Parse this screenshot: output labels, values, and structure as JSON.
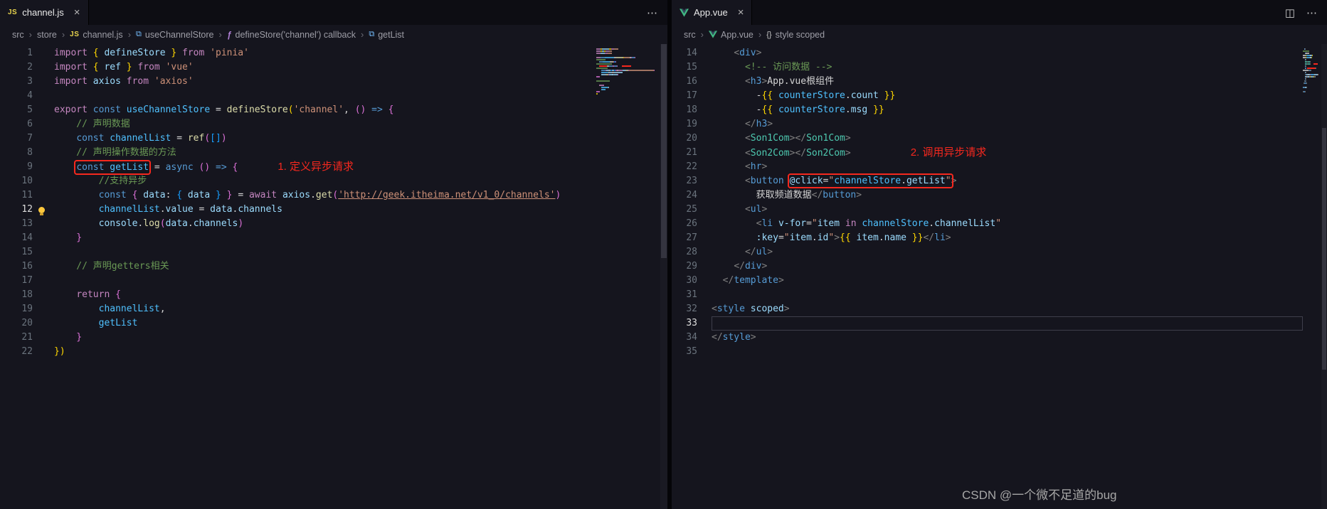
{
  "theme": {
    "editor_bg": "#15151e",
    "tabbar_bg": "#0d0d13",
    "annotation_red": "#f5281e"
  },
  "syntax": {
    "p": "#d4d4d4",
    "kw": "#c586c0",
    "st": "#569cd6",
    "v": "#9cdcfe",
    "cv": "#4fc1ff",
    "f": "#dcdcaa",
    "s": "#ce9178",
    "su": "#ce9178",
    "c": "#6a9955",
    "tp": "#808080",
    "ct": "#4ec9b0",
    "b1": "#ffd700",
    "b2": "#da70d6",
    "b3": "#179fff"
  },
  "left_pane": {
    "tab": {
      "badge": "JS",
      "label": "channel.js",
      "close": "×"
    },
    "actions": [
      {
        "name": "more-actions",
        "glyph": "⋯"
      }
    ],
    "breadcrumbs": [
      {
        "label": "src"
      },
      {
        "label": "store"
      },
      {
        "label": "channel.js",
        "icon": "js"
      },
      {
        "label": "useChannelStore",
        "icon": "sym"
      },
      {
        "label": "defineStore('channel') callback",
        "icon": "fn"
      },
      {
        "label": "getList",
        "icon": "sym"
      }
    ],
    "code": {
      "lines": [
        {
          "n": 1,
          "seg": [
            [
              "kw",
              "import "
            ],
            [
              "b1",
              "{ "
            ],
            [
              "v",
              "defineStore"
            ],
            [
              "b1",
              " } "
            ],
            [
              "kw",
              "from "
            ],
            [
              "s",
              "'pinia'"
            ]
          ]
        },
        {
          "n": 2,
          "seg": [
            [
              "kw",
              "import "
            ],
            [
              "b1",
              "{ "
            ],
            [
              "v",
              "ref"
            ],
            [
              "b1",
              " } "
            ],
            [
              "kw",
              "from "
            ],
            [
              "s",
              "'vue'"
            ]
          ]
        },
        {
          "n": 3,
          "seg": [
            [
              "kw",
              "import "
            ],
            [
              "v",
              "axios "
            ],
            [
              "kw",
              "from "
            ],
            [
              "s",
              "'axios'"
            ]
          ]
        },
        {
          "n": 4,
          "seg": []
        },
        {
          "n": 5,
          "seg": [
            [
              "kw",
              "export "
            ],
            [
              "st",
              "const "
            ],
            [
              "cv",
              "useChannelStore"
            ],
            [
              "p",
              " = "
            ],
            [
              "f",
              "defineStore"
            ],
            [
              "b1",
              "("
            ],
            [
              "s",
              "'channel'"
            ],
            [
              "p",
              ", "
            ],
            [
              "b2",
              "()"
            ],
            [
              "st",
              " => "
            ],
            [
              "b2",
              "{"
            ]
          ]
        },
        {
          "n": 6,
          "seg": [
            [
              "c",
              "    // 声明数据"
            ]
          ]
        },
        {
          "n": 7,
          "seg": [
            [
              "p",
              "    "
            ],
            [
              "st",
              "const "
            ],
            [
              "cv",
              "channelList"
            ],
            [
              "p",
              " = "
            ],
            [
              "f",
              "ref"
            ],
            [
              "b2",
              "("
            ],
            [
              "b3",
              "[]"
            ],
            [
              "b2",
              ")"
            ]
          ]
        },
        {
          "n": 8,
          "seg": [
            [
              "c",
              "    // 声明操作数据的方法"
            ]
          ]
        },
        {
          "n": 9,
          "seg": [
            [
              "p",
              "    "
            ],
            {
              "box": [
                [
                  "st",
                  "const "
                ],
                [
                  "cv",
                  "getList"
                ]
              ]
            },
            [
              "p",
              " = "
            ],
            [
              "st",
              "async "
            ],
            [
              "b2",
              "()"
            ],
            [
              "st",
              " => "
            ],
            [
              "b2",
              "{"
            ]
          ],
          "note": {
            "text": "1. 定义异步请求",
            "gap": 56
          }
        },
        {
          "n": 10,
          "seg": [
            [
              "c",
              "        //支持异步"
            ]
          ]
        },
        {
          "n": 11,
          "seg": [
            [
              "p",
              "        "
            ],
            [
              "st",
              "const "
            ],
            [
              "b2",
              "{ "
            ],
            [
              "v",
              "data"
            ],
            [
              "p",
              ": "
            ],
            [
              "b3",
              "{ "
            ],
            [
              "v",
              "data"
            ],
            [
              "b3",
              " }"
            ],
            [
              "b2",
              " }"
            ],
            [
              "p",
              " = "
            ],
            [
              "kw",
              "await "
            ],
            [
              "v",
              "axios"
            ],
            [
              "p",
              "."
            ],
            [
              "f",
              "get"
            ],
            [
              "b2",
              "("
            ],
            [
              "su",
              "'http://geek.itheima.net/v1_0/channels'"
            ],
            [
              "b2",
              ")"
            ]
          ]
        },
        {
          "n": 12,
          "bulb": true,
          "activeNum": true,
          "seg": [
            [
              "p",
              "        "
            ],
            [
              "cv",
              "channelList"
            ],
            [
              "p",
              "."
            ],
            [
              "v",
              "value"
            ],
            [
              "p",
              " = "
            ],
            [
              "v",
              "data"
            ],
            [
              "p",
              "."
            ],
            [
              "v",
              "channels"
            ]
          ]
        },
        {
          "n": 13,
          "seg": [
            [
              "p",
              "        "
            ],
            [
              "v",
              "console"
            ],
            [
              "p",
              "."
            ],
            [
              "f",
              "log"
            ],
            [
              "b2",
              "("
            ],
            [
              "v",
              "data"
            ],
            [
              "p",
              "."
            ],
            [
              "v",
              "channels"
            ],
            [
              "b2",
              ")"
            ]
          ]
        },
        {
          "n": 14,
          "seg": [
            [
              "b2",
              "    }"
            ]
          ]
        },
        {
          "n": 15,
          "seg": []
        },
        {
          "n": 16,
          "seg": [
            [
              "c",
              "    // 声明getters相关"
            ]
          ]
        },
        {
          "n": 17,
          "seg": []
        },
        {
          "n": 18,
          "seg": [
            [
              "p",
              "    "
            ],
            [
              "kw",
              "return "
            ],
            [
              "b2",
              "{"
            ]
          ]
        },
        {
          "n": 19,
          "seg": [
            [
              "p",
              "        "
            ],
            [
              "cv",
              "channelList"
            ],
            [
              "p",
              ","
            ]
          ]
        },
        {
          "n": 20,
          "seg": [
            [
              "p",
              "        "
            ],
            [
              "cv",
              "getList"
            ]
          ]
        },
        {
          "n": 21,
          "seg": [
            [
              "b2",
              "    }"
            ]
          ]
        },
        {
          "n": 22,
          "seg": [
            [
              "b1",
              "})"
            ]
          ]
        }
      ]
    }
  },
  "right_pane": {
    "tab": {
      "label": "App.vue",
      "close": "×"
    },
    "actions": [
      {
        "name": "split-editor",
        "glyph": "◫"
      },
      {
        "name": "more-actions",
        "glyph": "⋯"
      }
    ],
    "breadcrumbs": [
      {
        "label": "src"
      },
      {
        "label": "App.vue",
        "icon": "vue"
      },
      {
        "label": "style scoped",
        "icon": "braces"
      }
    ],
    "code": {
      "lines": [
        {
          "n": 14,
          "seg": [
            [
              "p",
              "    "
            ],
            [
              "tp",
              "<"
            ],
            [
              "st",
              "div"
            ],
            [
              "tp",
              ">"
            ]
          ]
        },
        {
          "n": 15,
          "seg": [
            [
              "c",
              "      <!-- 访问数据 -->"
            ]
          ]
        },
        {
          "n": 16,
          "seg": [
            [
              "p",
              "      "
            ],
            [
              "tp",
              "<"
            ],
            [
              "st",
              "h3"
            ],
            [
              "tp",
              ">"
            ],
            [
              "p",
              "App.vue根组件"
            ]
          ]
        },
        {
          "n": 17,
          "seg": [
            [
              "p",
              "        -"
            ],
            [
              "b1",
              "{{ "
            ],
            [
              "cv",
              "counterStore"
            ],
            [
              "p",
              "."
            ],
            [
              "v",
              "count"
            ],
            [
              "b1",
              " }}"
            ]
          ]
        },
        {
          "n": 18,
          "seg": [
            [
              "p",
              "        -"
            ],
            [
              "b1",
              "{{ "
            ],
            [
              "cv",
              "counterStore"
            ],
            [
              "p",
              "."
            ],
            [
              "v",
              "msg"
            ],
            [
              "b1",
              " }}"
            ]
          ]
        },
        {
          "n": 19,
          "seg": [
            [
              "p",
              "      "
            ],
            [
              "tp",
              "</"
            ],
            [
              "st",
              "h3"
            ],
            [
              "tp",
              ">"
            ]
          ]
        },
        {
          "n": 20,
          "seg": [
            [
              "p",
              "      "
            ],
            [
              "tp",
              "<"
            ],
            [
              "ct",
              "Son1Com"
            ],
            [
              "tp",
              "></"
            ],
            [
              "ct",
              "Son1Com"
            ],
            [
              "tp",
              ">"
            ]
          ]
        },
        {
          "n": 21,
          "seg": [
            [
              "p",
              "      "
            ],
            [
              "tp",
              "<"
            ],
            [
              "ct",
              "Son2Com"
            ],
            [
              "tp",
              "></"
            ],
            [
              "ct",
              "Son2Com"
            ],
            [
              "tp",
              ">"
            ]
          ],
          "note": {
            "text": "2. 调用异步请求",
            "gap": 84
          }
        },
        {
          "n": 22,
          "seg": [
            [
              "p",
              "      "
            ],
            [
              "tp",
              "<"
            ],
            [
              "st",
              "hr"
            ],
            [
              "tp",
              ">"
            ]
          ]
        },
        {
          "n": 23,
          "seg": [
            [
              "p",
              "      "
            ],
            [
              "tp",
              "<"
            ],
            [
              "st",
              "button"
            ],
            [
              "p",
              " "
            ],
            {
              "box": [
                [
                  "v",
                  "@click"
                ],
                [
                  "p",
                  "="
                ],
                [
                  "s",
                  "\""
                ],
                [
                  "cv",
                  "channelStore"
                ],
                [
                  "p",
                  "."
                ],
                [
                  "v",
                  "getList"
                ],
                [
                  "s",
                  "\""
                ]
              ]
            },
            [
              "tp",
              ">"
            ]
          ]
        },
        {
          "n": 24,
          "seg": [
            [
              "p",
              "        获取频道数据"
            ],
            [
              "tp",
              "</"
            ],
            [
              "st",
              "button"
            ],
            [
              "tp",
              ">"
            ]
          ]
        },
        {
          "n": 25,
          "seg": [
            [
              "p",
              "      "
            ],
            [
              "tp",
              "<"
            ],
            [
              "st",
              "ul"
            ],
            [
              "tp",
              ">"
            ]
          ]
        },
        {
          "n": 26,
          "seg": [
            [
              "p",
              "        "
            ],
            [
              "tp",
              "<"
            ],
            [
              "st",
              "li"
            ],
            [
              "p",
              " "
            ],
            [
              "v",
              "v-for"
            ],
            [
              "p",
              "="
            ],
            [
              "s",
              "\""
            ],
            [
              "v",
              "item"
            ],
            [
              "kw",
              " in "
            ],
            [
              "cv",
              "channelStore"
            ],
            [
              "p",
              "."
            ],
            [
              "v",
              "channelList"
            ],
            [
              "s",
              "\""
            ]
          ]
        },
        {
          "n": 27,
          "seg": [
            [
              "p",
              "        "
            ],
            [
              "v",
              ":key"
            ],
            [
              "p",
              "="
            ],
            [
              "s",
              "\""
            ],
            [
              "v",
              "item"
            ],
            [
              "p",
              "."
            ],
            [
              "v",
              "id"
            ],
            [
              "s",
              "\""
            ],
            [
              "tp",
              ">"
            ],
            [
              "b1",
              "{{ "
            ],
            [
              "v",
              "item"
            ],
            [
              "p",
              "."
            ],
            [
              "v",
              "name"
            ],
            [
              "b1",
              " }}"
            ],
            [
              "tp",
              "</"
            ],
            [
              "st",
              "li"
            ],
            [
              "tp",
              ">"
            ]
          ]
        },
        {
          "n": 28,
          "seg": [
            [
              "p",
              "      "
            ],
            [
              "tp",
              "</"
            ],
            [
              "st",
              "ul"
            ],
            [
              "tp",
              ">"
            ]
          ]
        },
        {
          "n": 29,
          "seg": [
            [
              "p",
              "    "
            ],
            [
              "tp",
              "</"
            ],
            [
              "st",
              "div"
            ],
            [
              "tp",
              ">"
            ]
          ]
        },
        {
          "n": 30,
          "seg": [
            [
              "p",
              "  "
            ],
            [
              "tp",
              "</"
            ],
            [
              "st",
              "template"
            ],
            [
              "tp",
              ">"
            ]
          ]
        },
        {
          "n": 31,
          "seg": []
        },
        {
          "n": 32,
          "seg": [
            [
              "tp",
              "<"
            ],
            [
              "st",
              "style"
            ],
            [
              "p",
              " "
            ],
            [
              "v",
              "scoped"
            ],
            [
              "tp",
              ">"
            ]
          ]
        },
        {
          "n": 33,
          "active": true,
          "seg": []
        },
        {
          "n": 34,
          "seg": [
            [
              "tp",
              "</"
            ],
            [
              "st",
              "style"
            ],
            [
              "tp",
              ">"
            ]
          ]
        },
        {
          "n": 35,
          "seg": []
        }
      ]
    }
  },
  "watermark": "CSDN @一个微不足道的bug"
}
